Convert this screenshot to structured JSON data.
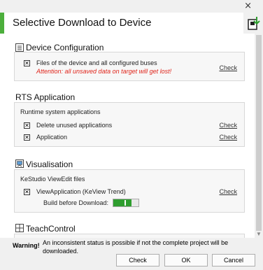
{
  "window": {
    "close_glyph": "×"
  },
  "header": {
    "title": "Selective Download to Device",
    "icon": "device-download-icon",
    "accent": "#4caf3c"
  },
  "sections": {
    "device_configuration": {
      "title": "Device Configuration",
      "item_label": "Files of the device and all configured buses",
      "warning": "Attention: all unsaved data on target will get lost!",
      "check": "Check"
    },
    "rts_application": {
      "title": "RTS Application",
      "subtitle": "Runtime system applications",
      "items": [
        {
          "label": "Delete unused applications",
          "check": "Check"
        },
        {
          "label": "Application",
          "check": "Check"
        }
      ]
    },
    "visualisation": {
      "title": "Visualisation",
      "subtitle": "KeStudio ViewEdit files",
      "item_label": "ViewApplication (KeView Trend)",
      "check": "Check",
      "build_label": "Build before Download:",
      "build_enabled": true
    },
    "teachcontrol": {
      "title": "TeachControl"
    }
  },
  "footer": {
    "warning_label": "Warning!",
    "warning_text": "An inconsistent status is possible if not the complete project will be downloaded.",
    "buttons": {
      "check": "Check",
      "ok": "OK",
      "cancel": "Cancel"
    }
  },
  "colors": {
    "warning_red": "#e0241a",
    "toggle_on": "#2f9e2f"
  }
}
